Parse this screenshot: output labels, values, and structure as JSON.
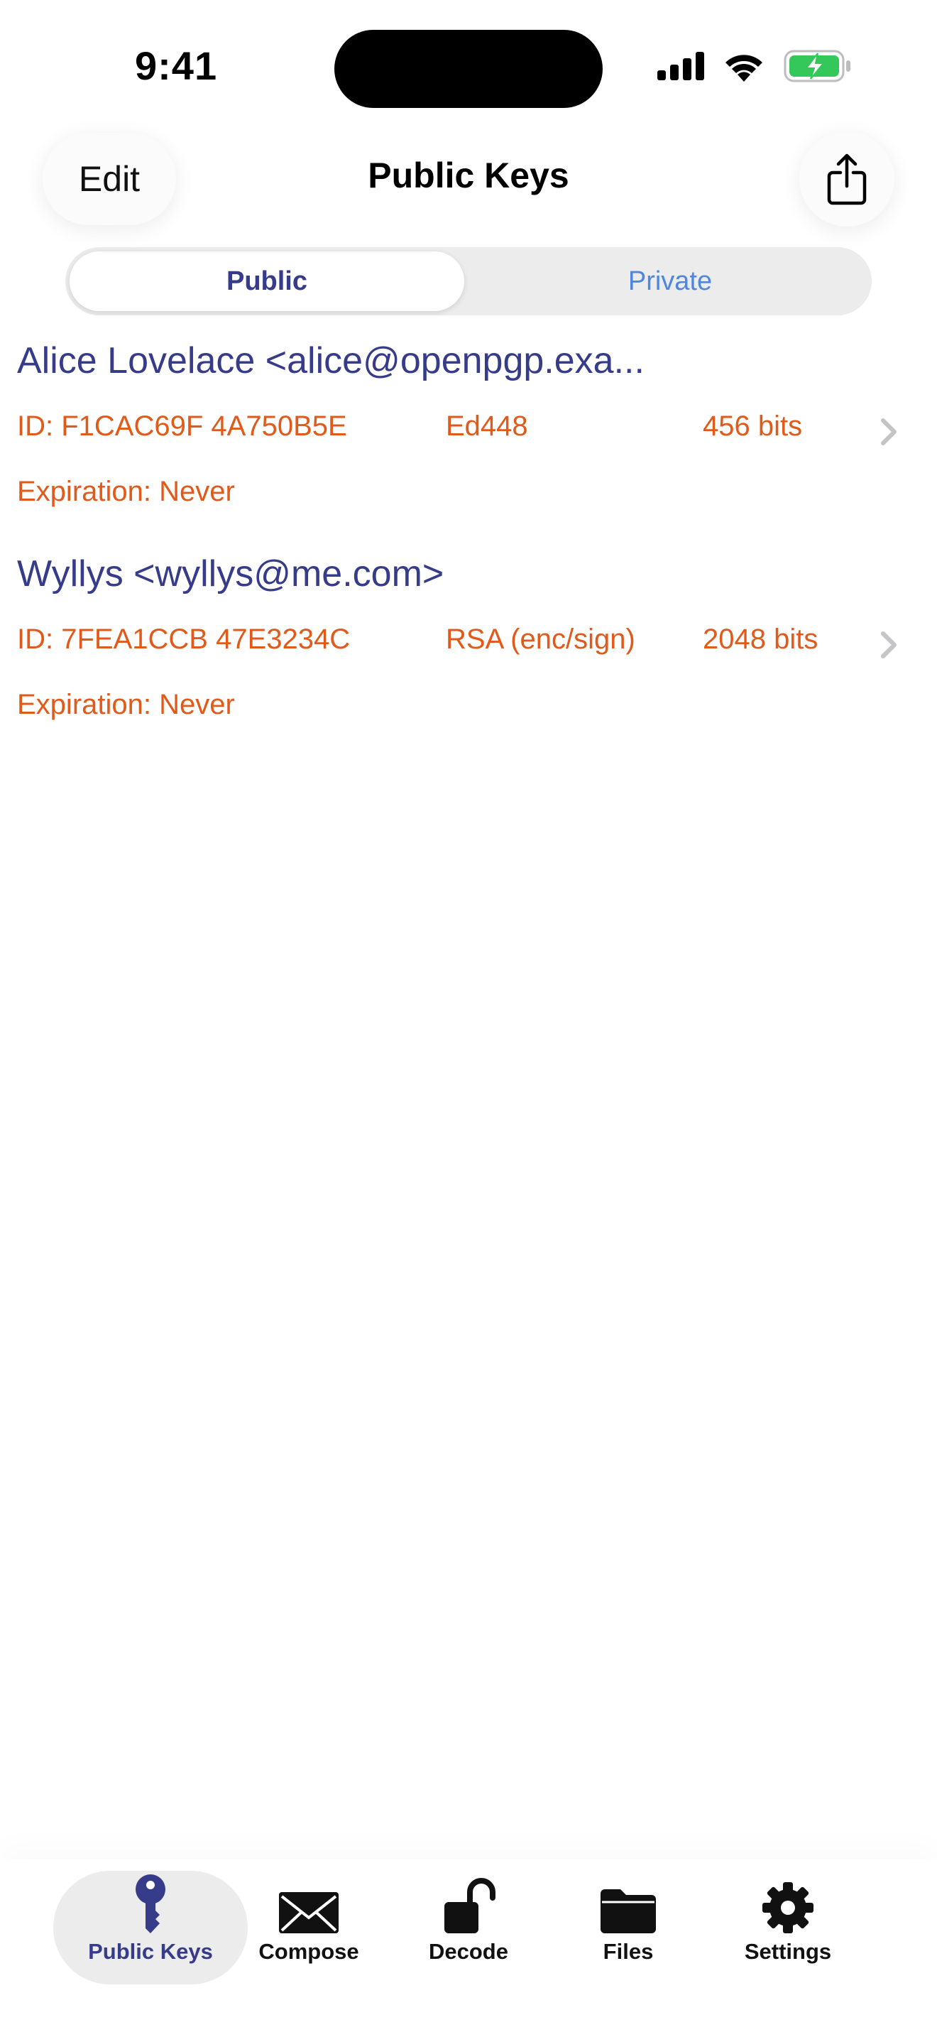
{
  "status_bar": {
    "time": "9:41"
  },
  "nav": {
    "edit_label": "Edit",
    "title": "Public Keys"
  },
  "segmented": {
    "public_label": "Public",
    "private_label": "Private",
    "selected": "Public"
  },
  "keys": [
    {
      "name": "Alice Lovelace <alice@openpgp.exa...",
      "id": "ID: F1CAC69F 4A750B5E",
      "algorithm": "Ed448",
      "bits": "456 bits",
      "expiration": "Expiration: Never"
    },
    {
      "name": "Wyllys <wyllys@me.com>",
      "id": "ID: 7FEA1CCB 47E3234C",
      "algorithm": "RSA (enc/sign)",
      "bits": "2048 bits",
      "expiration": "Expiration: Never"
    }
  ],
  "tab_bar": {
    "tabs": [
      {
        "label": "Public Keys",
        "icon": "key-icon",
        "active": true
      },
      {
        "label": "Compose",
        "icon": "envelope-icon"
      },
      {
        "label": "Decode",
        "icon": "unlock-icon"
      },
      {
        "label": "Files",
        "icon": "folder-icon"
      },
      {
        "label": "Settings",
        "icon": "gear-icon"
      }
    ]
  },
  "colors": {
    "accent": "#363b8a",
    "detail": "#e15a1a",
    "private_tab": "#4f86df",
    "battery": "#34c759"
  }
}
